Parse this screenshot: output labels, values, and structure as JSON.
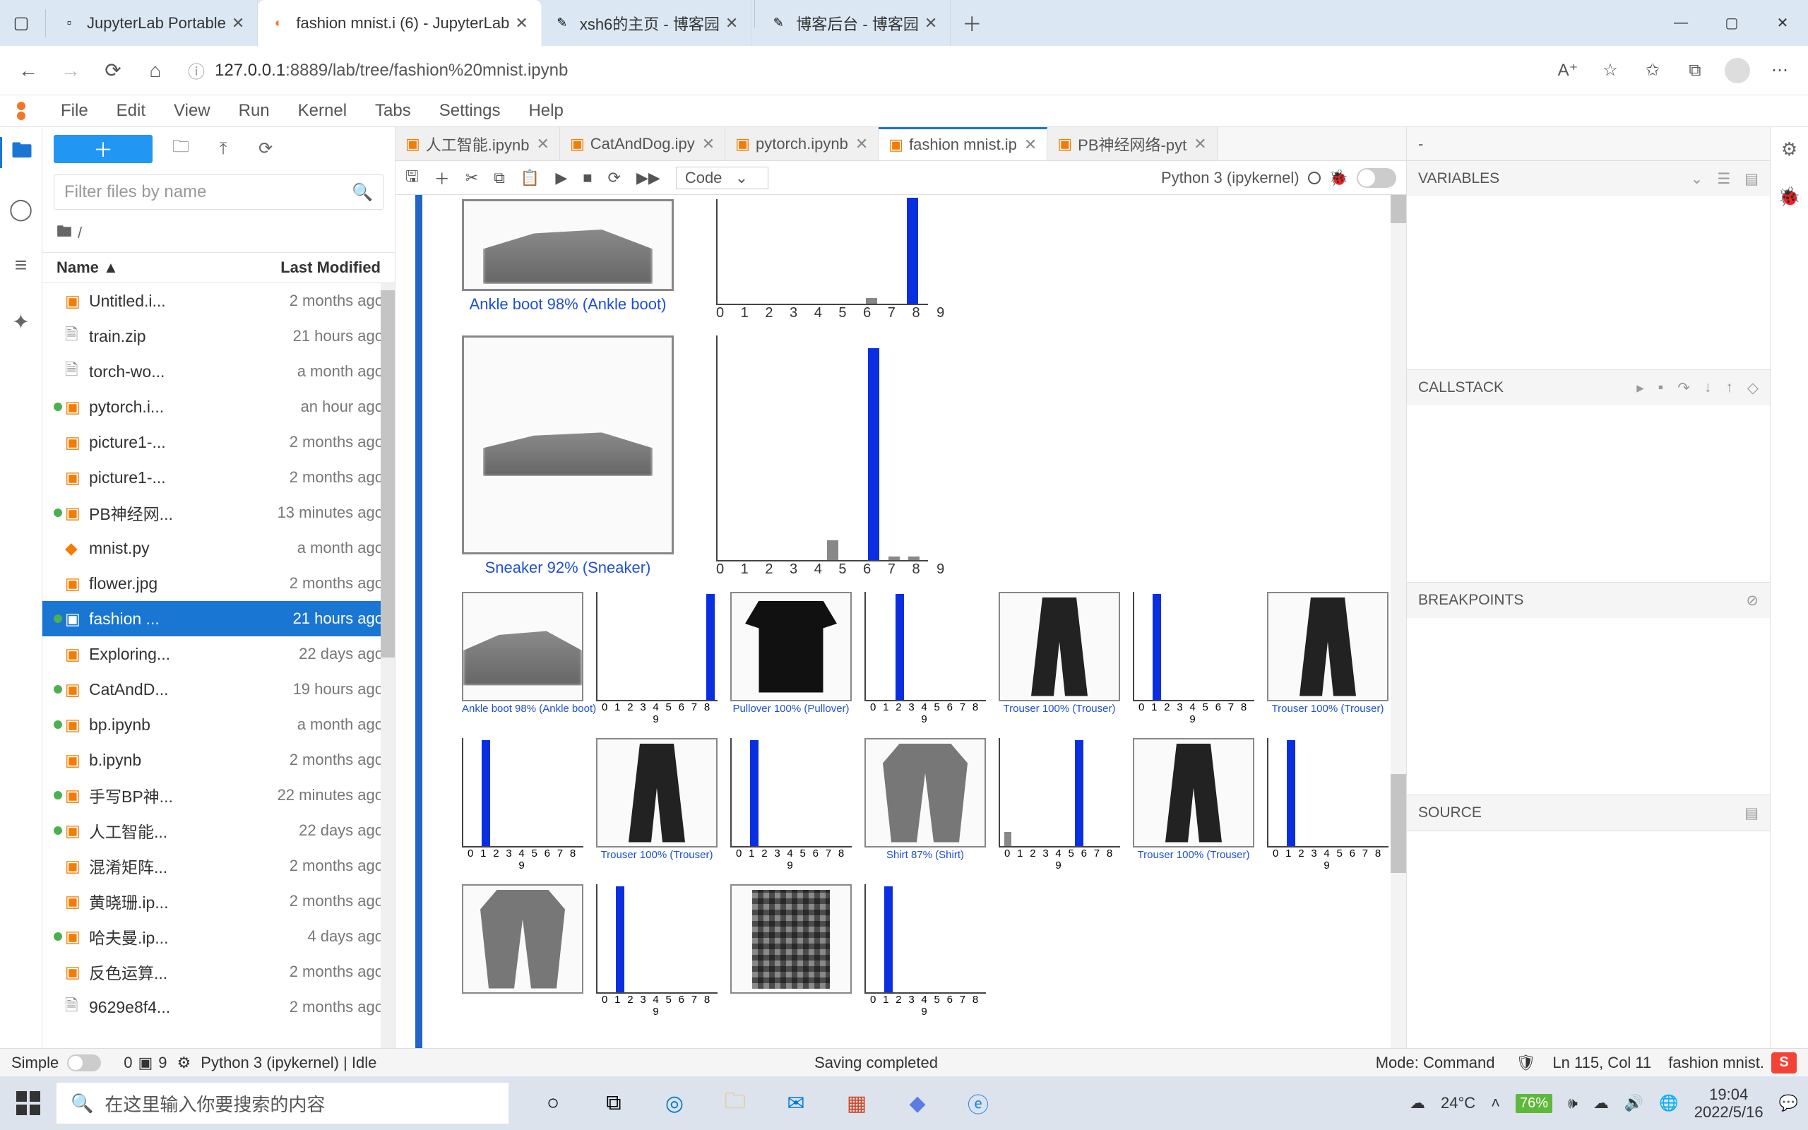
{
  "browser": {
    "tabs": [
      {
        "label": "JupyterLab Portable",
        "active": false
      },
      {
        "label": "fashion mnist.i (6) - JupyterLab",
        "active": true
      },
      {
        "label": "xsh6的主页 - 博客园",
        "active": false
      },
      {
        "label": "博客后台 - 博客园",
        "active": false
      }
    ],
    "url_host": "127.0.0.1",
    "url_port": ":8889",
    "url_path": "/lab/tree/fashion%20mnist.ipynb"
  },
  "jupyter": {
    "menu": [
      "File",
      "Edit",
      "View",
      "Run",
      "Kernel",
      "Tabs",
      "Settings",
      "Help"
    ],
    "filebrowser": {
      "filter_placeholder": "Filter files by name",
      "crumb": "/",
      "header_name": "Name",
      "header_sort": "▲",
      "header_mod": "Last Modified",
      "files": [
        {
          "dot": false,
          "icon": "txt",
          "name": "9629e8f4...",
          "mod": "2 months ago"
        },
        {
          "dot": false,
          "icon": "nb",
          "name": "反色运算...",
          "mod": "2 months ago"
        },
        {
          "dot": true,
          "icon": "nb",
          "name": "哈夫曼.ip...",
          "mod": "4 days ago"
        },
        {
          "dot": false,
          "icon": "nb",
          "name": "黄晓珊.ip...",
          "mod": "2 months ago"
        },
        {
          "dot": false,
          "icon": "nb",
          "name": "混淆矩阵...",
          "mod": "2 months ago"
        },
        {
          "dot": true,
          "icon": "nb",
          "name": "人工智能...",
          "mod": "22 days ago"
        },
        {
          "dot": true,
          "icon": "nb",
          "name": "手写BP神...",
          "mod": "22 minutes ago"
        },
        {
          "dot": false,
          "icon": "nb",
          "name": "b.ipynb",
          "mod": "2 months ago"
        },
        {
          "dot": true,
          "icon": "nb",
          "name": "bp.ipynb",
          "mod": "a month ago"
        },
        {
          "dot": true,
          "icon": "nb",
          "name": "CatAndD...",
          "mod": "19 hours ago"
        },
        {
          "dot": false,
          "icon": "nb",
          "name": "Exploring...",
          "mod": "22 days ago"
        },
        {
          "dot": true,
          "icon": "nb",
          "name": "fashion ...",
          "mod": "21 hours ago",
          "selected": true
        },
        {
          "dot": false,
          "icon": "nb",
          "name": "flower.jpg",
          "mod": "2 months ago"
        },
        {
          "dot": false,
          "icon": "py",
          "name": "mnist.py",
          "mod": "a month ago"
        },
        {
          "dot": true,
          "icon": "nb",
          "name": "PB神经网...",
          "mod": "13 minutes ago"
        },
        {
          "dot": false,
          "icon": "nb",
          "name": "picture1-...",
          "mod": "2 months ago"
        },
        {
          "dot": false,
          "icon": "nb",
          "name": "picture1-...",
          "mod": "2 months ago"
        },
        {
          "dot": true,
          "icon": "nb",
          "name": "pytorch.i...",
          "mod": "an hour ago"
        },
        {
          "dot": false,
          "icon": "txt",
          "name": "torch-wo...",
          "mod": "a month ago"
        },
        {
          "dot": false,
          "icon": "txt",
          "name": "train.zip",
          "mod": "21 hours ago"
        },
        {
          "dot": false,
          "icon": "nb",
          "name": "Untitled.i...",
          "mod": "2 months ago"
        }
      ]
    },
    "nb_tabs": [
      {
        "label": "人工智能.ipynb"
      },
      {
        "label": "CatAndDog.ipy"
      },
      {
        "label": "pytorch.ipynb"
      },
      {
        "label": "fashion mnist.ip",
        "active": true
      },
      {
        "label": "PB神经网络-pyt"
      }
    ],
    "toolbar": {
      "celltype": "Code",
      "kernel": "Python 3 (ipykernel)"
    },
    "rp_tab": "-",
    "variables": "VARIABLES",
    "callstack": "CALLSTACK",
    "breakpoints": "BREAKPOINTS",
    "source": "SOURCE"
  },
  "chart_data": [
    {
      "type": "bar",
      "title": "Ankle boot 98% (Ankle boot)",
      "categories": [
        "0",
        "1",
        "2",
        "3",
        "4",
        "5",
        "6",
        "7",
        "8",
        "9"
      ],
      "values": [
        0,
        0,
        0,
        0,
        0,
        0,
        0,
        2,
        0,
        98
      ],
      "predicted_index": 9,
      "ylim": [
        0,
        100
      ]
    },
    {
      "type": "bar",
      "title": "Sneaker 92% (Sneaker)",
      "categories": [
        "0",
        "1",
        "2",
        "3",
        "4",
        "5",
        "6",
        "7",
        "8",
        "9"
      ],
      "values": [
        0,
        0,
        0,
        0,
        0,
        6,
        0,
        92,
        1,
        1
      ],
      "predicted_index": 7,
      "ylim": [
        0,
        100
      ]
    },
    {
      "type": "bar",
      "title": "Ankle boot 98% (Ankle boot)",
      "categories": [
        "0",
        "1",
        "2",
        "3",
        "4",
        "5",
        "6",
        "7",
        "8",
        "9"
      ],
      "values": [
        0,
        0,
        0,
        0,
        0,
        0,
        0,
        1,
        0,
        98
      ],
      "predicted_index": 9,
      "ylim": [
        0,
        100
      ]
    },
    {
      "type": "bar",
      "title": "Pullover 100% (Pullover)",
      "categories": [
        "0",
        "1",
        "2",
        "3",
        "4",
        "5",
        "6",
        "7",
        "8",
        "9"
      ],
      "values": [
        0,
        0,
        100,
        0,
        0,
        0,
        0,
        0,
        0,
        0
      ],
      "predicted_index": 2,
      "ylim": [
        0,
        100
      ]
    },
    {
      "type": "bar",
      "title": "Trouser 100% (Trouser)",
      "categories": [
        "0",
        "1",
        "2",
        "3",
        "4",
        "5",
        "6",
        "7",
        "8",
        "9"
      ],
      "values": [
        0,
        100,
        0,
        0,
        0,
        0,
        0,
        0,
        0,
        0
      ],
      "predicted_index": 1,
      "ylim": [
        0,
        100
      ]
    },
    {
      "type": "bar",
      "title": "Trouser 100% (Trouser)",
      "categories": [
        "0",
        "1",
        "2",
        "3",
        "4",
        "5",
        "6",
        "7",
        "8",
        "9"
      ],
      "values": [
        0,
        100,
        0,
        0,
        0,
        0,
        0,
        0,
        0,
        0
      ],
      "predicted_index": 1,
      "ylim": [
        0,
        100
      ]
    },
    {
      "type": "bar",
      "title": "Trouser 100% (Trouser)",
      "categories": [
        "0",
        "1",
        "2",
        "3",
        "4",
        "5",
        "6",
        "7",
        "8",
        "9"
      ],
      "values": [
        0,
        100,
        0,
        0,
        0,
        0,
        0,
        0,
        0,
        0
      ],
      "predicted_index": 1,
      "ylim": [
        0,
        100
      ]
    },
    {
      "type": "bar",
      "title": "Shirt 87% (Shirt)",
      "categories": [
        "0",
        "1",
        "2",
        "3",
        "4",
        "5",
        "6",
        "7",
        "8",
        "9"
      ],
      "values": [
        10,
        0,
        1,
        1,
        1,
        0,
        87,
        0,
        0,
        0
      ],
      "predicted_index": 6,
      "ylim": [
        0,
        100
      ]
    },
    {
      "type": "bar",
      "title": "Trouser 100% (Trouser)",
      "categories": [
        "0",
        "1",
        "2",
        "3",
        "4",
        "5",
        "6",
        "7",
        "8",
        "9"
      ],
      "values": [
        0,
        100,
        0,
        0,
        0,
        0,
        0,
        0,
        0,
        0
      ],
      "predicted_index": 1,
      "ylim": [
        0,
        100
      ]
    }
  ],
  "statusbar": {
    "simple": "Simple",
    "count0": "0",
    "terminals_icon": "▣",
    "count1": "9",
    "gear": "⚙",
    "kernel": "Python 3 (ipykernel) | Idle",
    "saving": "Saving completed",
    "mode": "Mode: Command",
    "lncol": "Ln 115, Col 11",
    "file": "fashion mnist.",
    "badge": "S"
  },
  "taskbar": {
    "search_placeholder": "在这里输入你要搜索的内容",
    "weather_temp": "24°C",
    "battery": "76%",
    "time": "19:04",
    "date": "2022/5/16"
  }
}
